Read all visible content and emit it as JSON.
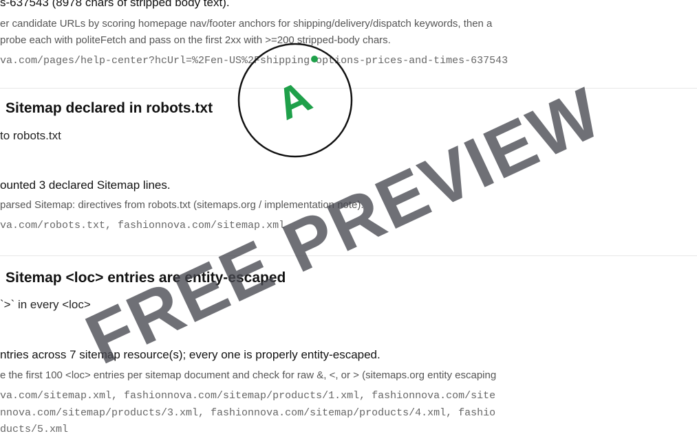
{
  "sections": [
    {
      "id": "shipping",
      "result": "s-637543 (8978 chars of stripped body text).",
      "note_line1": "er candidate URLs by scoring homepage nav/footer anchors for shipping/delivery/dispatch keywords, then a",
      "note_line2": "probe each with politeFetch and pass on the first 2xx with >=200 stripped-body chars.",
      "evidence": "va.com/pages/help-center?hcUrl=%2Fen-US%2Fshipping-options-prices-and-times-637543"
    },
    {
      "id": "sitemap-robots",
      "title": "Sitemap declared in robots.txt",
      "subtitle": "to robots.txt",
      "result": "ounted 3 declared Sitemap lines.",
      "note": "parsed Sitemap: directives from robots.txt (sitemaps.org / implementation note).",
      "evidence": "va.com/robots.txt, fashionnova.com/sitemap.xml"
    },
    {
      "id": "sitemap-escaped",
      "title": "Sitemap <loc> entries are entity-escaped",
      "subtitle": "`>` in every <loc>",
      "result": "ntries across 7 sitemap resource(s); every one is properly entity-escaped.",
      "note": "e the first 100 <loc> entries per sitemap document and check for raw &, <, or > (sitemaps.org entity escaping",
      "evidence_line1": "va.com/sitemap.xml, fashionnova.com/sitemap/products/1.xml, fashionnova.com/site",
      "evidence_line2": "nnova.com/sitemap/products/3.xml, fashionnova.com/sitemap/products/4.xml, fashio",
      "evidence_line3": "ducts/5.xml"
    }
  ],
  "grade_badge": {
    "letter": "A",
    "color": "#1fa04a",
    "ring_color": "#111111"
  },
  "watermark": {
    "text": "FREE PREVIEW",
    "color": "#464850"
  }
}
